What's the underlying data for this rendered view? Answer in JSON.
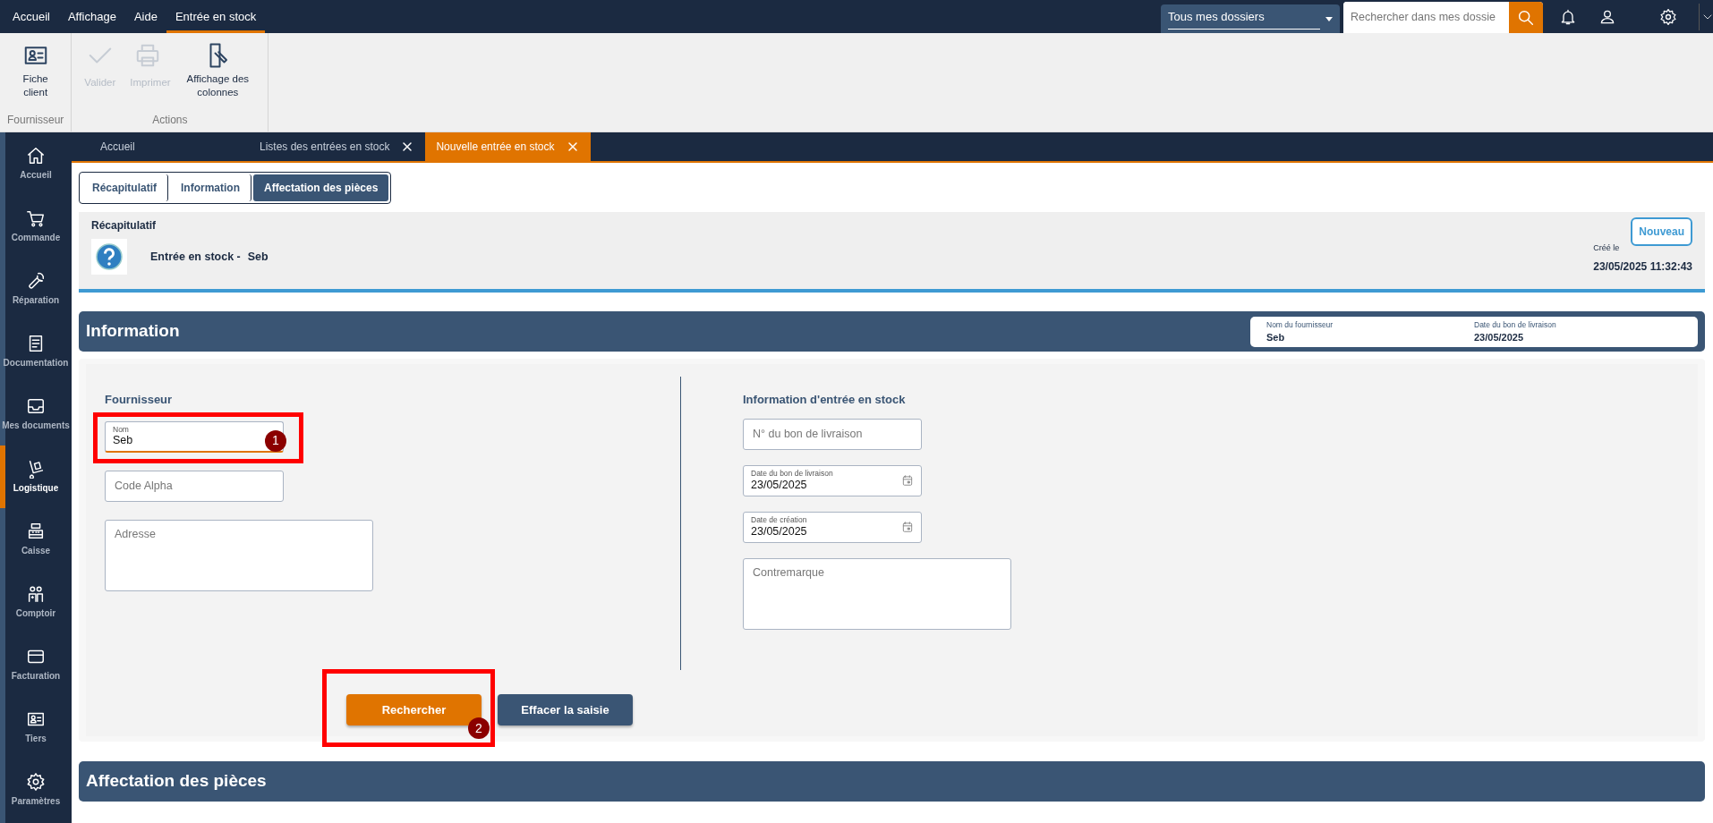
{
  "menu": [
    {
      "label": "Accueil",
      "selected": false
    },
    {
      "label": "Affichage",
      "selected": false
    },
    {
      "label": "Aide",
      "selected": false
    },
    {
      "label": "Entrée en stock",
      "selected": true
    }
  ],
  "folder_select": {
    "value": "Tous mes dossiers"
  },
  "search": {
    "placeholder": "Rechercher dans mes dossie"
  },
  "ribbon": [
    {
      "label": "Fournisseur",
      "buttons": [
        {
          "label": "Fiche client",
          "kind": "idcard",
          "disabled": false
        }
      ]
    },
    {
      "label": "Actions",
      "buttons": [
        {
          "label": "Valider",
          "kind": "check",
          "disabled": true
        },
        {
          "label": "Imprimer",
          "kind": "printer",
          "disabled": true
        },
        {
          "label": "Affichage des colonnes",
          "kind": "columns",
          "disabled": false
        }
      ]
    }
  ],
  "sidebar": [
    {
      "label": "Accueil",
      "kind": "home",
      "selected": false
    },
    {
      "label": "Commande",
      "kind": "cart",
      "selected": false
    },
    {
      "label": "Réparation",
      "kind": "wrench",
      "selected": false
    },
    {
      "label": "Documentation",
      "kind": "document",
      "selected": false
    },
    {
      "label": "Mes documents",
      "kind": "inbox",
      "selected": false
    },
    {
      "label": "Logistique",
      "kind": "dolly",
      "selected": true
    },
    {
      "label": "Caisse",
      "kind": "register",
      "selected": false
    },
    {
      "label": "Comptoir",
      "kind": "people",
      "selected": false
    },
    {
      "label": "Facturation",
      "kind": "card",
      "selected": false
    },
    {
      "label": "Tiers",
      "kind": "idcard",
      "selected": false
    },
    {
      "label": "Paramètres",
      "kind": "gear",
      "selected": false
    }
  ],
  "doc_tabs": [
    {
      "label": "Accueil",
      "selected": false,
      "closable": false
    },
    {
      "label": "Listes des entrées en stock",
      "selected": false,
      "closable": true
    },
    {
      "label": "Nouvelle entrée en stock",
      "selected": true,
      "closable": true
    }
  ],
  "section_tabs": [
    {
      "label": "Récapitulatif",
      "selected": false
    },
    {
      "label": "Information",
      "selected": false
    },
    {
      "label": "Affectation des pièces",
      "selected": true
    }
  ],
  "summary": {
    "title": "Récapitulatif",
    "button": "Nouveau",
    "entry_label": "Entrée en stock -",
    "entry_name": "Seb",
    "created_label": "Créé le",
    "created_value": "23/05/2025 11:32:43"
  },
  "information": {
    "title": "Information",
    "info_fields": [
      {
        "label": "Nom du fournisseur",
        "value": "Seb"
      },
      {
        "label": "Date du bon de livraison",
        "value": "23/05/2025"
      }
    ],
    "left": {
      "title": "Fournisseur",
      "fields": [
        {
          "kind": "text",
          "label": "Nom",
          "value": "Seb",
          "focused": true,
          "callout": "1"
        },
        {
          "kind": "text",
          "placeholder": "Code Alpha",
          "focused": false
        },
        {
          "kind": "textarea",
          "placeholder": "Adresse"
        }
      ]
    },
    "right": {
      "title": "Information d'entrée en stock",
      "fields": [
        {
          "kind": "text",
          "placeholder": "N° du bon de livraison",
          "focused": false
        },
        {
          "kind": "date",
          "label": "Date du bon de livraison",
          "value": "23/05/2025"
        },
        {
          "kind": "date",
          "label": "Date de création",
          "value": "23/05/2025"
        },
        {
          "kind": "textarea",
          "placeholder": "Contremarque"
        }
      ]
    },
    "buttons": [
      {
        "label": "Rechercher",
        "kind": "primary",
        "callout": "2"
      },
      {
        "label": "Effacer la saisie",
        "kind": "secondary"
      }
    ]
  },
  "parts": {
    "title": "Affectation des pièces"
  }
}
